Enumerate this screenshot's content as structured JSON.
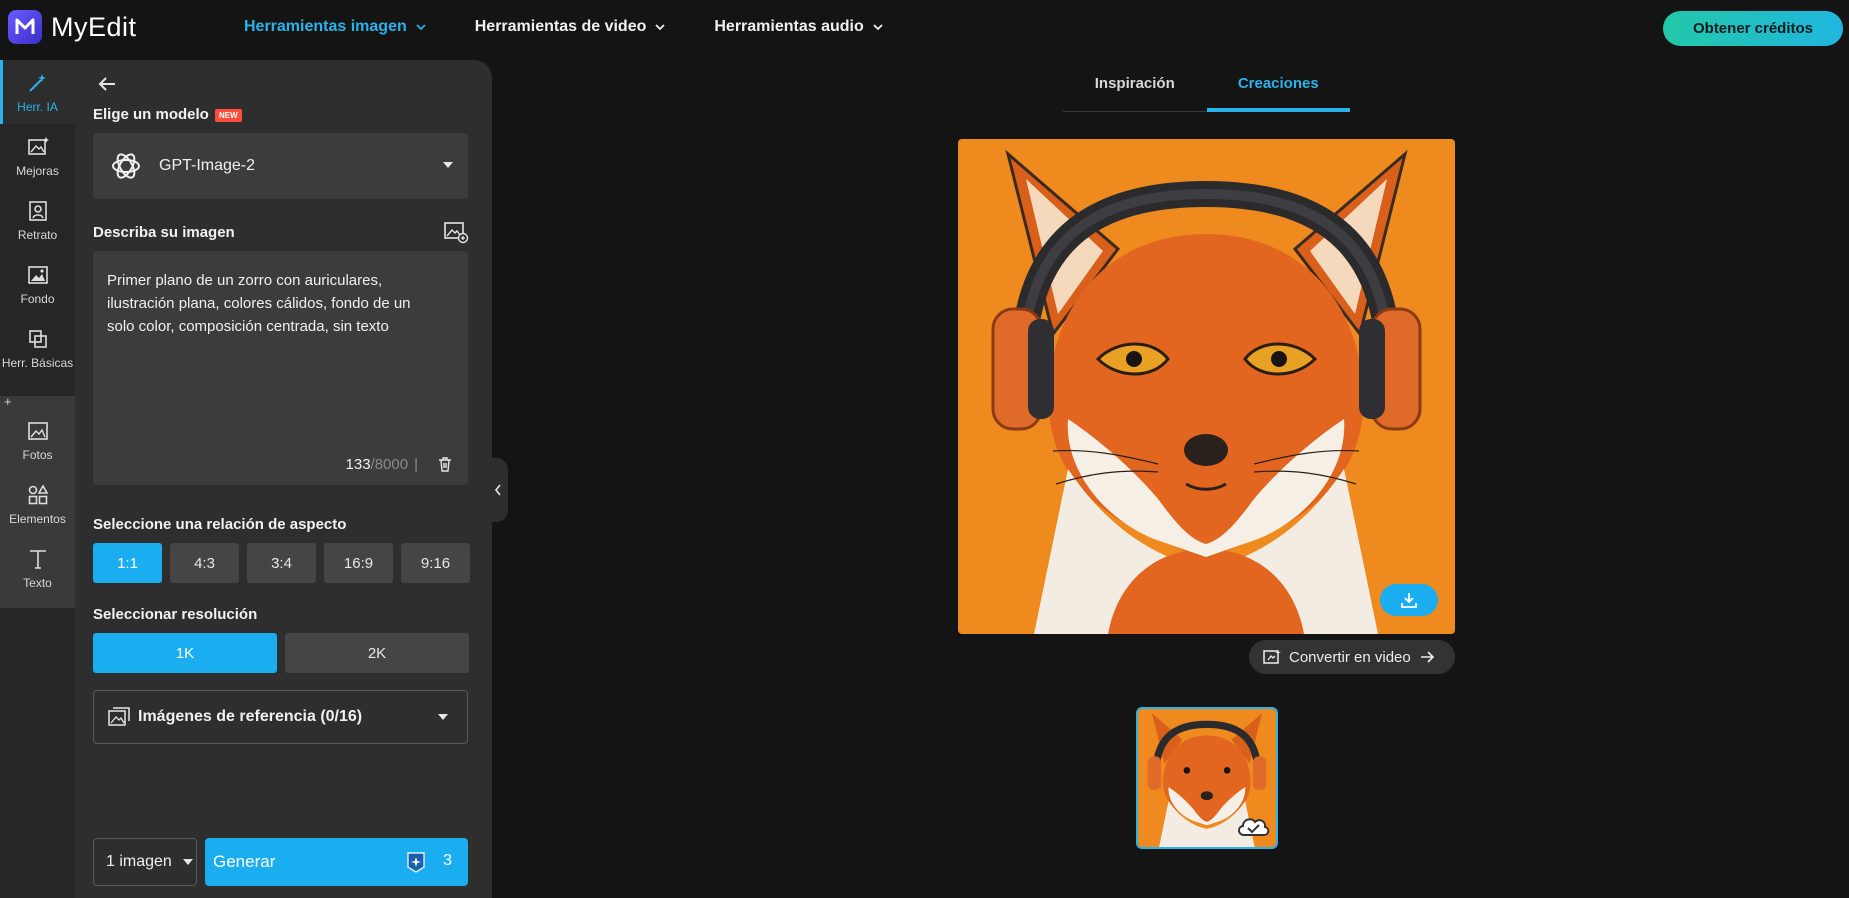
{
  "app": {
    "name": "MyEdit"
  },
  "topnav": {
    "items": [
      {
        "label": "Herramientas imagen"
      },
      {
        "label": "Herramientas de video"
      },
      {
        "label": "Herramientas audio"
      }
    ],
    "credits_button": "Obtener créditos"
  },
  "rail": {
    "items": [
      {
        "label": "Herr. IA",
        "icon": "magic-wand-icon"
      },
      {
        "label": "Mejoras",
        "icon": "image-enhance-icon"
      },
      {
        "label": "Retrato",
        "icon": "portrait-icon"
      },
      {
        "label": "Fondo",
        "icon": "background-icon"
      },
      {
        "label": "Herr. Básicas",
        "icon": "crop-icon"
      },
      {
        "label": "Fotos",
        "icon": "photo-icon"
      },
      {
        "label": "Elementos",
        "icon": "shapes-icon"
      },
      {
        "label": "Texto",
        "icon": "text-icon"
      }
    ],
    "plus_label": "+"
  },
  "panel": {
    "model_section": {
      "label": "Elige un modelo",
      "badge": "NEW",
      "selected": "GPT-Image-2"
    },
    "prompt_section": {
      "label": "Describa su imagen",
      "text": "Primer plano de un zorro con auriculares,\nilustración plana, colores cálidos, fondo de un\nsolo color, composición centrada, sin texto",
      "count": "133",
      "max": "/8000",
      "separator": "|"
    },
    "aspect_section": {
      "label": "Seleccione una relación de aspecto",
      "options": [
        "1:1",
        "4:3",
        "3:4",
        "16:9",
        "9:16"
      ],
      "selected": "1:1"
    },
    "resolution_section": {
      "label": "Seleccionar resolución",
      "options": [
        "1K",
        "2K"
      ],
      "selected": "1K"
    },
    "reference": {
      "label": "Imágenes de referencia (0/16)"
    },
    "count_select": {
      "value": "1 imagen"
    },
    "generate": {
      "label": "Generar",
      "credits": "3"
    }
  },
  "main": {
    "tabs": [
      {
        "label": "Inspiración"
      },
      {
        "label": "Creaciones"
      }
    ],
    "active_tab": "Creaciones",
    "convert_button": "Convertir en video"
  },
  "colors": {
    "accent": "#1aaef0",
    "image_bg": "#ef8a1e"
  }
}
